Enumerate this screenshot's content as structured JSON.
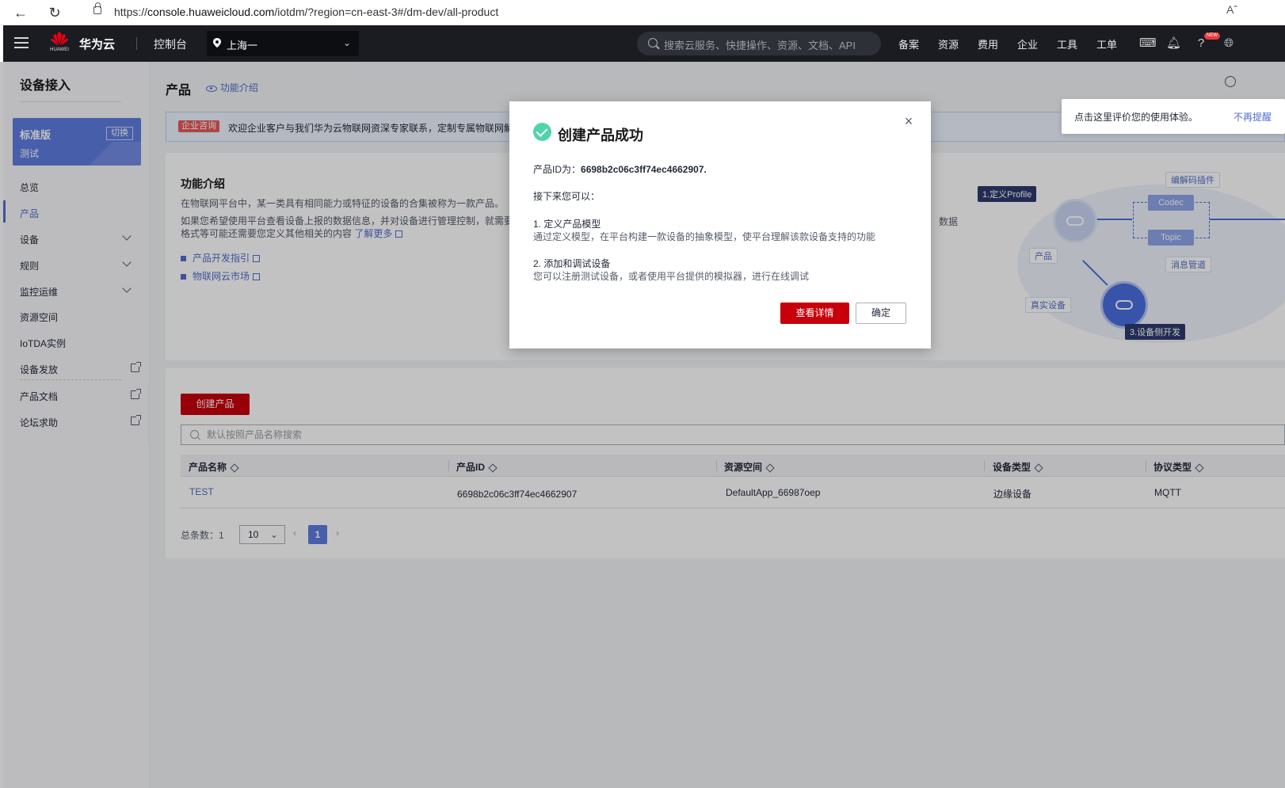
{
  "browser": {
    "url_prefix": "https://",
    "url_host": "console.huaweicloud.com",
    "url_path": "/iotdm/?region=cn-east-3#/dm-dev/all-product",
    "reader_label": "Aˆ"
  },
  "topnav": {
    "brand": "华为云",
    "logo_sub": "HUAWEI",
    "console": "控制台",
    "region": "上海一",
    "search_placeholder": "搜索云服务、快捷操作、资源、文档、API",
    "links": [
      "备案",
      "资源",
      "费用",
      "企业",
      "工具",
      "工单"
    ],
    "new_badge": "NEW"
  },
  "sidebar": {
    "title": "设备接入",
    "edition_name": "标准版",
    "edition_sub": "测试",
    "switch_label": "切换",
    "items": [
      {
        "label": "总览"
      },
      {
        "label": "产品"
      },
      {
        "label": "设备"
      },
      {
        "label": "规则"
      },
      {
        "label": "监控运维"
      },
      {
        "label": "资源空间"
      },
      {
        "label": "IoTDA实例"
      },
      {
        "label": "设备发放"
      },
      {
        "label": "产品文档"
      },
      {
        "label": "论坛求助"
      }
    ]
  },
  "main": {
    "page_title": "产品",
    "intro_link": "功能介绍",
    "notice_tag": "企业咨询",
    "notice_text": "欢迎企业客户与我们华为云物联网资深专家联系，定制专属物联网解决",
    "feedback_text": "点击这里评价您的使用体验。",
    "feedback_link": "不再提醒",
    "intro": {
      "title": "功能介绍",
      "desc1": "在物联网平台中，某一类具有相同能力或特征的设备的合集被称为一款产品。",
      "desc2": "如果您希望使用平台查看设备上报的数据信息，并对设备进行管理控制，就需要开",
      "desc2_end": "格式等可能还需要您定义其他相关的内容",
      "desc_tail": "数据",
      "learn_more": "了解更多",
      "links": [
        "产品开发指引",
        "物联网云市场"
      ]
    },
    "diagram": {
      "step1": "1.定义Profile",
      "step3": "3.设备侧开发",
      "codec_plugin": "编解码插件",
      "codec": "Codec",
      "topic": "Topic",
      "msg_pipe": "消息管道",
      "product": "产品",
      "real_device": "真实设备"
    },
    "create_button": "创建产品",
    "search_placeholder": "默认按照产品名称搜索",
    "table": {
      "columns": [
        "产品名称",
        "产品ID",
        "资源空间",
        "设备类型",
        "协议类型"
      ],
      "rows": [
        [
          "TEST",
          "6698b2c06c3ff74ec4662907",
          "DefaultApp_66987oep",
          "边缘设备",
          "MQTT"
        ]
      ]
    },
    "pager": {
      "total_label": "总条数：",
      "total": "1",
      "page_size": "10",
      "current_page": "1"
    }
  },
  "modal": {
    "title": "创建产品成功",
    "id_label": "产品ID为：",
    "id_value": "6698b2c06c3ff74ec4662907.",
    "next_label": "接下来您可以：",
    "step1_title": "1. 定义产品模型",
    "step1_desc": "通过定义模型，在平台构建一款设备的抽象模型，使平台理解该款设备支持的功能",
    "step2_title": "2. 添加和调试设备",
    "step2_desc": "您可以注册测试设备，或者使用平台提供的模拟器，进行在线调试",
    "primary_button": "查看详情",
    "secondary_button": "确定"
  },
  "colors": {
    "brand_red": "#c7000b",
    "accent_blue": "#526ecc",
    "success_green": "#50d4ab",
    "topnav_bg": "#1a1c22"
  }
}
